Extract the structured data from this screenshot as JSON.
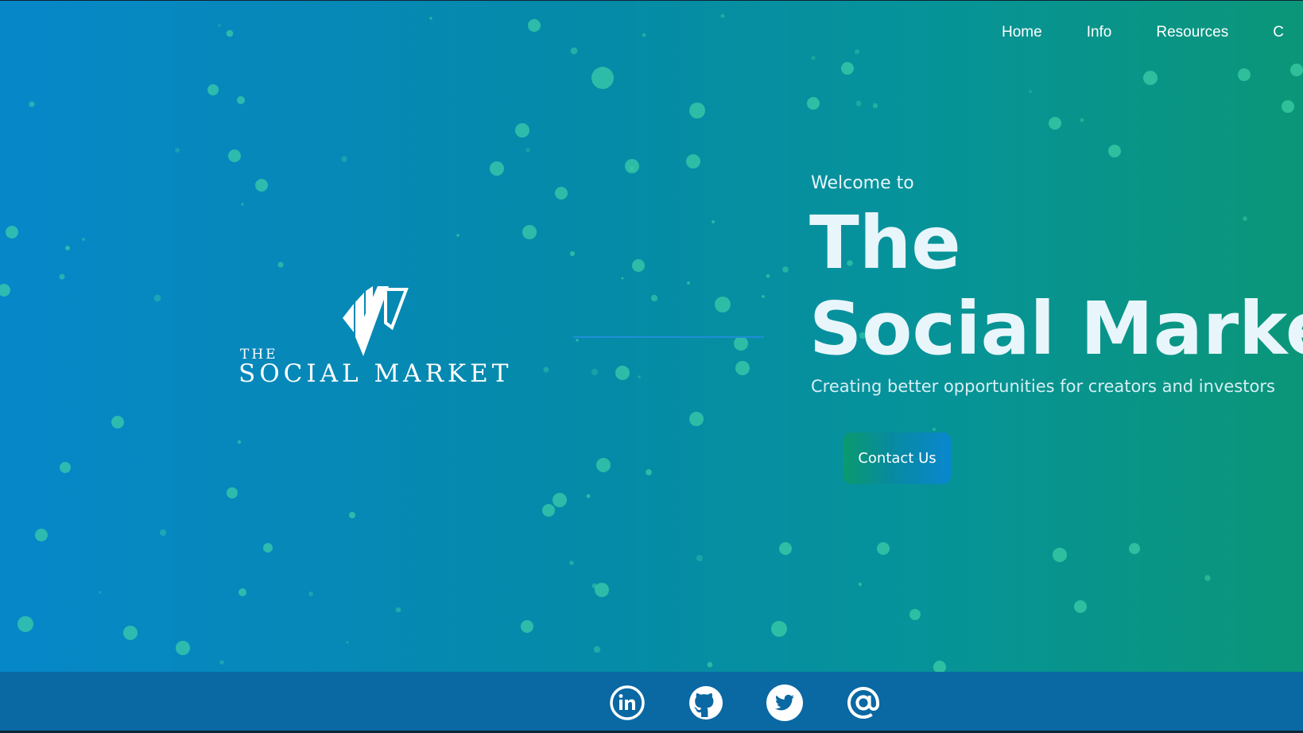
{
  "nav": {
    "items": [
      {
        "label": "Home"
      },
      {
        "label": "Info"
      },
      {
        "label": "Resources"
      },
      {
        "label": "C"
      }
    ]
  },
  "logo": {
    "icon": "social-market-logo-mark",
    "line1": "THE",
    "line2": "SOCIAL MARKET"
  },
  "hero": {
    "welcome": "Welcome to",
    "title_line1": "The",
    "title_line2": "Social Market",
    "subtitle": "Creating better opportunities for creators and investors",
    "cta_label": "Contact Us"
  },
  "footer": {
    "social": [
      {
        "icon": "linkedin-icon"
      },
      {
        "icon": "github-icon"
      },
      {
        "icon": "twitter-icon"
      },
      {
        "icon": "at-email-icon"
      }
    ]
  },
  "colors": {
    "gradient_left": "#0687c9",
    "gradient_right": "#0b9679",
    "particle": "#3fd1a8",
    "footer": "#0a68a3",
    "text": "#e8f6fb"
  }
}
